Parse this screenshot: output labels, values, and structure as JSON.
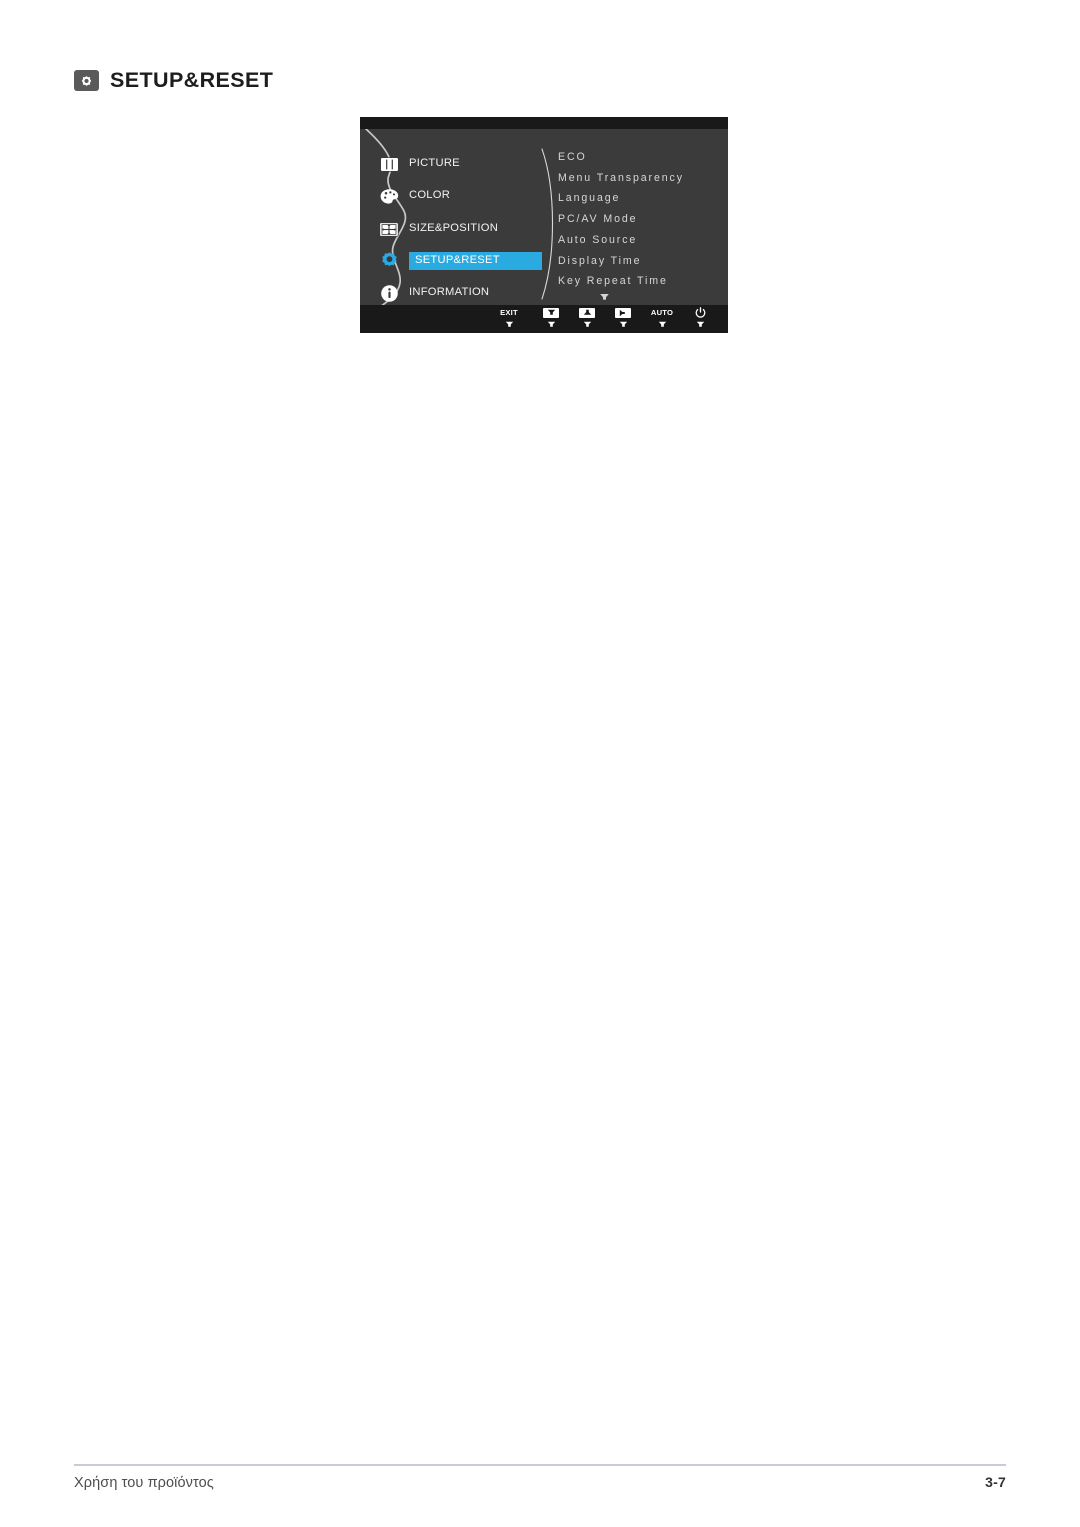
{
  "header": {
    "icon": "setup-reset-icon",
    "title": "SETUP&RESET"
  },
  "osd": {
    "sidebar": {
      "items": [
        {
          "id": "picture",
          "label": "PICTURE",
          "icon": "picture-bars-icon",
          "selected": false
        },
        {
          "id": "color",
          "label": "COLOR",
          "icon": "color-palette-icon",
          "selected": false
        },
        {
          "id": "size",
          "label": "SIZE&POSITION",
          "icon": "size-position-icon",
          "selected": false
        },
        {
          "id": "setup",
          "label": "SETUP&RESET",
          "icon": "gear-icon",
          "selected": true
        },
        {
          "id": "information",
          "label": "INFORMATION",
          "icon": "info-circle-icon",
          "selected": false
        }
      ]
    },
    "menu": {
      "items": [
        {
          "label": "ECO"
        },
        {
          "label": "Menu Transparency"
        },
        {
          "label": "Language"
        },
        {
          "label": "PC/AV Mode"
        },
        {
          "label": "Auto Source"
        },
        {
          "label": "Display Time"
        },
        {
          "label": "Key Repeat Time"
        }
      ],
      "scroll_indicator": "chevron-down-icon"
    },
    "controls": [
      {
        "id": "exit",
        "caption": "EXIT",
        "glyph": "text",
        "sub": "chevron-down-icon"
      },
      {
        "id": "down",
        "caption": "",
        "glyph": "down-arrow",
        "sub": "chevron-down-icon"
      },
      {
        "id": "up",
        "caption": "",
        "glyph": "up-arrow",
        "sub": "chevron-down-icon"
      },
      {
        "id": "enter",
        "caption": "",
        "glyph": "right-arrow",
        "sub": "chevron-down-icon"
      },
      {
        "id": "auto",
        "caption": "AUTO",
        "glyph": "text",
        "sub": "chevron-down-icon"
      },
      {
        "id": "power",
        "caption": "",
        "glyph": "power",
        "sub": "chevron-down-icon"
      }
    ],
    "colors": {
      "panel_bg": "#3b3b3b",
      "bar_bg": "#191919",
      "highlight": "#29abe2",
      "text": "#d6d6d6"
    }
  },
  "footer": {
    "left": "Χρήση του προϊόντος",
    "right": "3-7"
  }
}
